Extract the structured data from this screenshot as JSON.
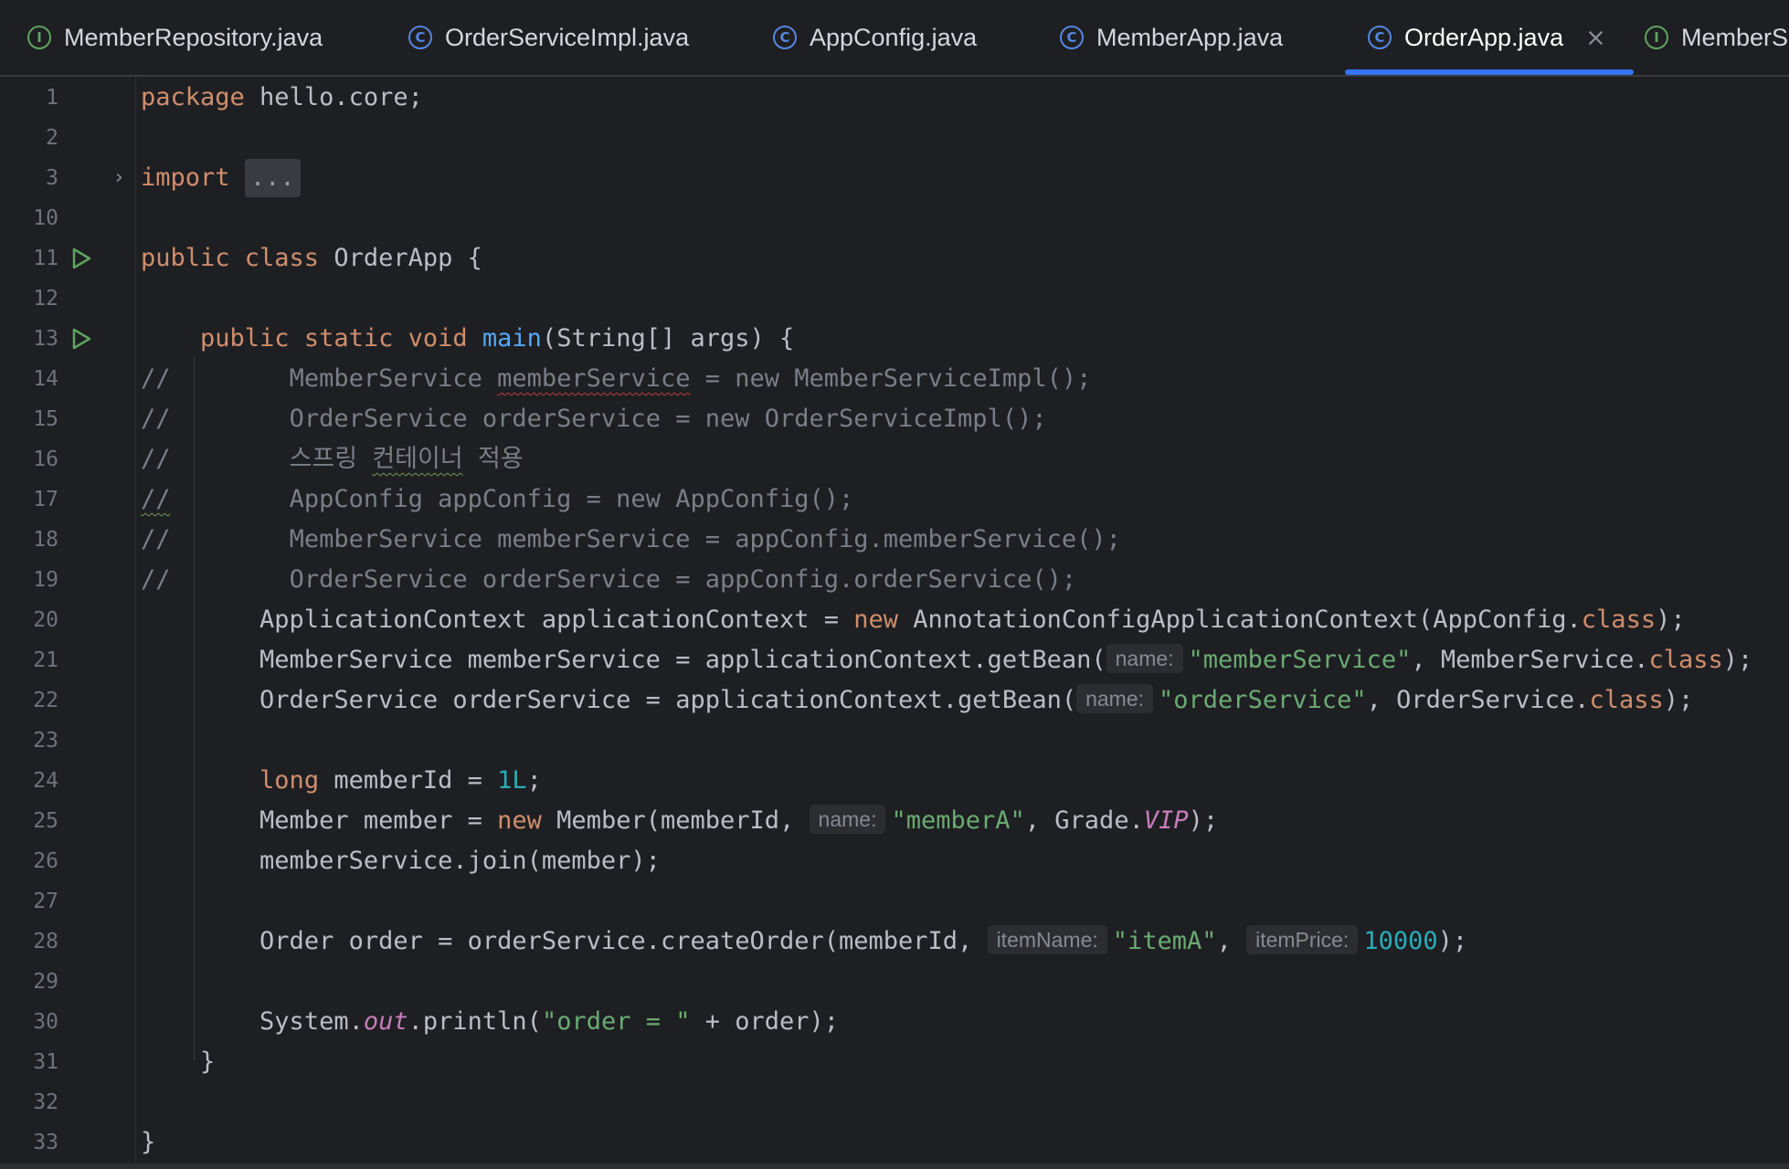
{
  "tabs": [
    {
      "label": "MemberRepository.java",
      "icon": "interface-icon",
      "icon_glyph": "I"
    },
    {
      "label": "OrderServiceImpl.java",
      "icon": "class-icon",
      "icon_glyph": "C"
    },
    {
      "label": "AppConfig.java",
      "icon": "class-icon",
      "icon_glyph": "C"
    },
    {
      "label": "MemberApp.java",
      "icon": "class-icon",
      "icon_glyph": "C"
    },
    {
      "label": "OrderApp.java",
      "icon": "class-icon",
      "icon_glyph": "C",
      "active": true,
      "close": "×"
    },
    {
      "label": "MemberS",
      "icon": "interface-icon",
      "icon_glyph": "I"
    }
  ],
  "editor": {
    "line_numbers": [
      "1",
      "2",
      "3",
      "10",
      "11",
      "12",
      "13",
      "14",
      "15",
      "16",
      "17",
      "18",
      "19",
      "20",
      "21",
      "22",
      "23",
      "24",
      "25",
      "26",
      "27",
      "28",
      "29",
      "30",
      "31",
      "32",
      "33"
    ],
    "fold_glyph": "›",
    "code": {
      "l1_kw": "package",
      "l1_rest": " hello.core;",
      "l3_kw": "import",
      "l3_folded": "...",
      "l11_kw": "public class",
      "l11_rest": " OrderApp {",
      "l13_kw": "public static void",
      "l13_fn": "main",
      "l13_rest": "(String[] args) {",
      "c_prefix": "//",
      "l14_a": "MemberService ",
      "l14_b": "memberService",
      "l14_c": " = new MemberServiceImpl();",
      "l15": "OrderService orderService = new OrderServiceImpl();",
      "l16_a": "스프링 ",
      "l16_b": "컨테이너",
      "l16_c": " 적용",
      "l17": "AppConfig appConfig = new AppConfig();",
      "l18": "MemberService memberService = appConfig.memberService();",
      "l19": "OrderService orderService = appConfig.orderService();",
      "l20_a": "ApplicationContext applicationContext = ",
      "l20_kw": "new",
      "l20_b": " AnnotationConfigApplicationContext(AppConfig.",
      "l20_kw2": "class",
      "l20_c": ");",
      "l21_a": "MemberService memberService = applicationContext.getBean(",
      "l21_hint": "name:",
      "l21_str": "\"memberService\"",
      "l21_b": ", MemberService.",
      "l21_kw": "class",
      "l21_c": ");",
      "l22_a": "OrderService orderService = applicationContext.getBean(",
      "l22_hint": "name:",
      "l22_str": "\"orderService\"",
      "l22_b": ", OrderService.",
      "l22_kw": "class",
      "l22_c": ");",
      "l24_kw": "long",
      "l24_a": " memberId = ",
      "l24_num": "1L",
      "l24_b": ";",
      "l25_a": "Member member = ",
      "l25_kw": "new",
      "l25_b": " Member(memberId, ",
      "l25_hint": "name:",
      "l25_str": "\"memberA\"",
      "l25_c": ", Grade.",
      "l25_stat": "VIP",
      "l25_d": ");",
      "l26": "memberService.join(member);",
      "l28_a": "Order order = orderService.createOrder(memberId, ",
      "l28_hint1": "itemName:",
      "l28_str": "\"itemA\"",
      "l28_b": ", ",
      "l28_hint2": "itemPrice:",
      "l28_num": "10000",
      "l28_c": ");",
      "l30_a": "System.",
      "l30_stat": "out",
      "l30_b": ".println(",
      "l30_str": "\"order = \"",
      "l30_c": " + order);",
      "l31": "}",
      "l33": "}"
    }
  },
  "colors": {
    "background": "#1e1f22",
    "keyword": "#cf8e6d",
    "string": "#6aab73",
    "number": "#2aacb8",
    "function": "#56a8f5",
    "static_field": "#c77dbb",
    "comment": "#7a7e85",
    "active_tab_underline": "#3574f0",
    "run_icon": "#5fa35f"
  }
}
